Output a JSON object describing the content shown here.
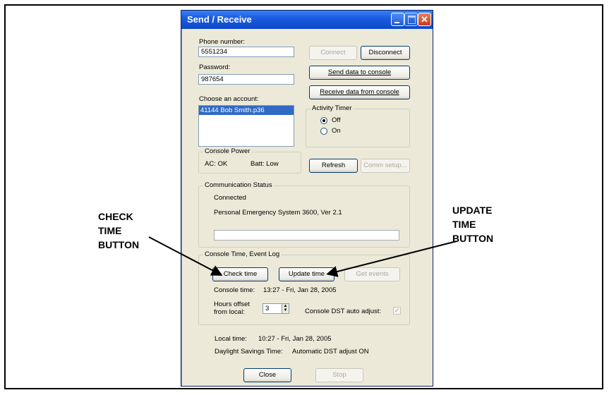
{
  "window": {
    "title": "Send / Receive"
  },
  "phone": {
    "label": "Phone number:",
    "value": "5551234"
  },
  "password": {
    "label": "Password:",
    "value": "987654"
  },
  "account": {
    "label": "Choose an account:",
    "selected": "41144 Bob Smith.p36"
  },
  "buttons": {
    "connect": "Connect",
    "disconnect": "Disconnect",
    "send": "Send data to console",
    "receive": "Receive data from console",
    "refresh": "Refresh",
    "comm_setup": "Comm setup...",
    "check_time": "Check time",
    "update_time": "Update time",
    "get_events": "Get events",
    "close": "Close",
    "stop": "Stop"
  },
  "activity_timer": {
    "title": "Activity Timer",
    "off": "Off",
    "on": "On"
  },
  "console_power": {
    "title": "Console Power",
    "ac": "AC: OK",
    "batt": "Batt: Low"
  },
  "comm_status": {
    "title": "Communication Status",
    "line1": "Connected",
    "line2": "Personal Emergency System 3600, Ver 2.1"
  },
  "time_log": {
    "title": "Console Time, Event Log",
    "console_time_label": "Console time:",
    "console_time_value": "13:27  -  Fri, Jan 28, 2005",
    "hours_offset_label1": "Hours offset",
    "hours_offset_label2": "from local:",
    "hours_offset_value": "3",
    "dst_label": "Console DST auto adjust:"
  },
  "local_time": {
    "label": "Local time:",
    "value": "10:27  -  Fri, Jan 28, 2005"
  },
  "dst": {
    "label": "Daylight Savings Time:",
    "value": "Automatic DST adjust ON"
  },
  "callouts": {
    "check_time": [
      "CHECK",
      "TIME",
      "BUTTON"
    ],
    "update_time": [
      "UPDATE",
      "TIME",
      "BUTTON"
    ]
  }
}
